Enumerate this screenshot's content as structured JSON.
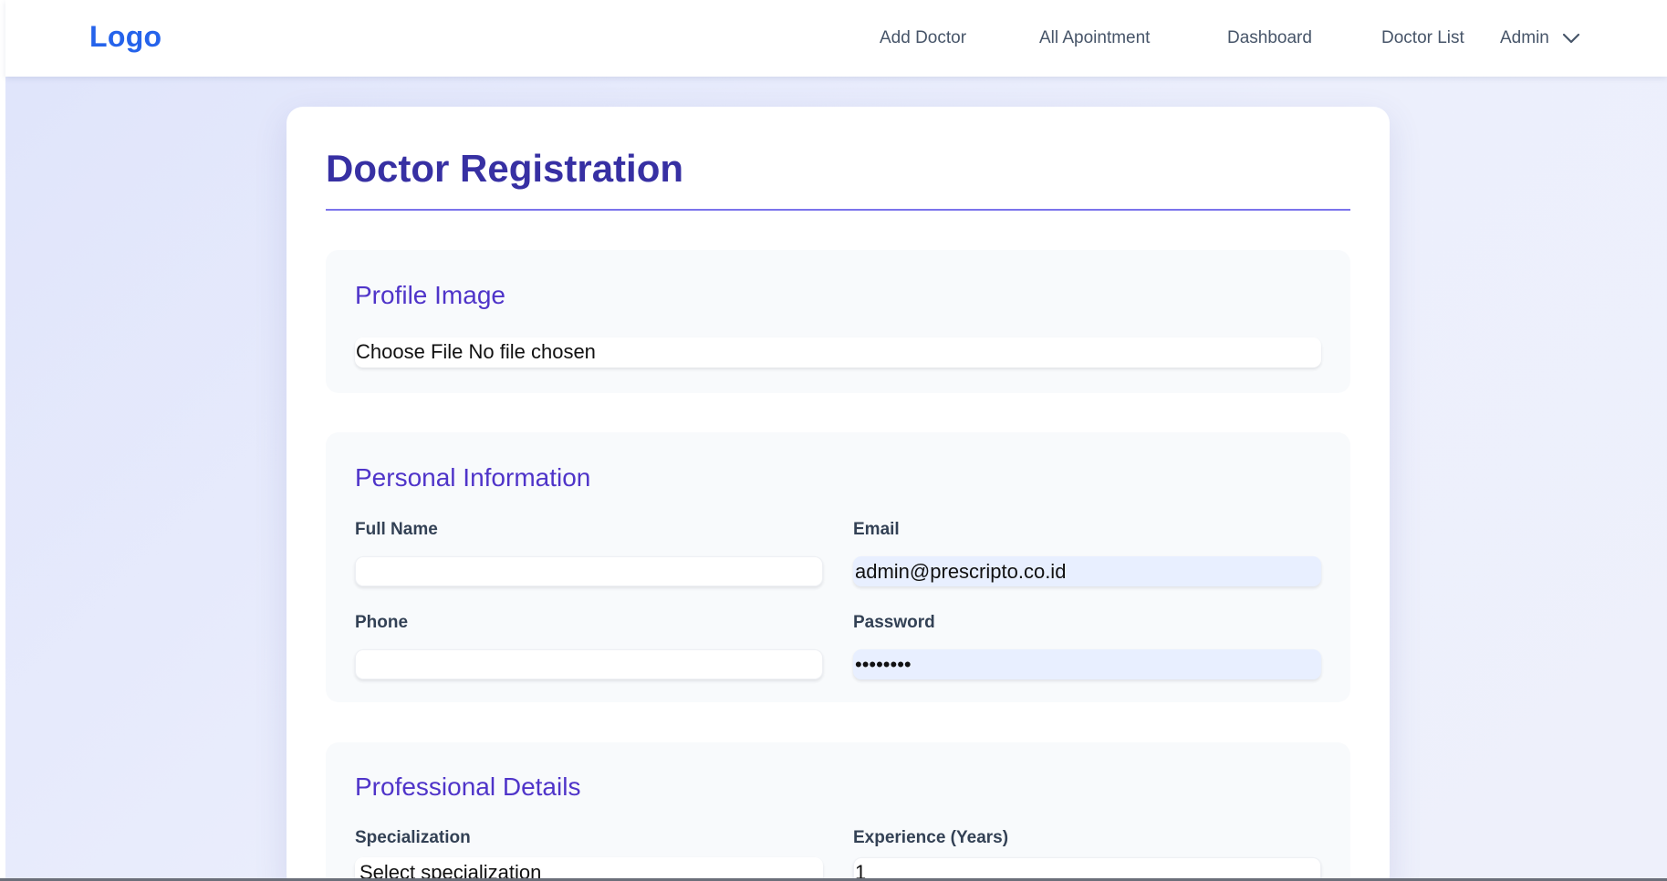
{
  "header": {
    "logo": "Logo",
    "nav": {
      "add_doctor": "Add Doctor",
      "all_appointment": "All Apointment",
      "dashboard": "Dashboard",
      "doctor_list": "Doctor List"
    },
    "admin_menu": {
      "label": "Admin",
      "icon": "chevron-down-icon"
    }
  },
  "form": {
    "title": "Doctor Registration",
    "profile_image": {
      "heading": "Profile Image",
      "file_input_text": "Choose File No file chosen"
    },
    "personal_information": {
      "heading": "Personal Information",
      "full_name": {
        "label": "Full Name",
        "value": ""
      },
      "email": {
        "label": "Email",
        "value": "admin@prescripto.co.id"
      },
      "phone": {
        "label": "Phone",
        "value": ""
      },
      "password": {
        "label": "Password",
        "value": "••••••••"
      }
    },
    "professional_details": {
      "heading": "Professional Details",
      "specialization": {
        "label": "Specialization",
        "value": "Select specialization"
      },
      "experience": {
        "label": "Experience (Years)",
        "value": "1"
      }
    }
  },
  "colors": {
    "logo": "#2563eb",
    "title": "#3730a3",
    "section_heading": "#4f34c9",
    "autofill_bg": "#e8efff"
  }
}
